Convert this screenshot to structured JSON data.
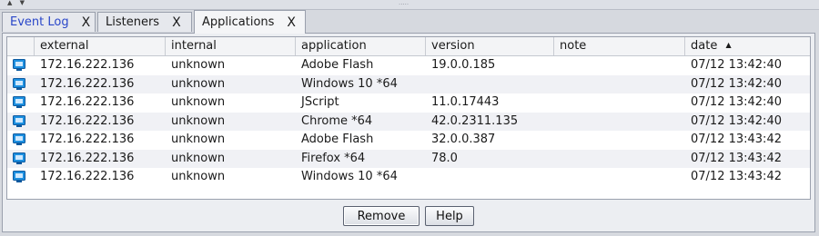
{
  "topbar": {
    "arrows": "▲ ▼",
    "grip": "·····"
  },
  "tabs": [
    {
      "label": "Event Log",
      "close": "X"
    },
    {
      "label": "Listeners",
      "close": "X"
    },
    {
      "label": "Applications",
      "close": "X"
    }
  ],
  "table": {
    "columns": [
      "",
      "external",
      "internal",
      "application",
      "version",
      "note",
      "date"
    ],
    "sort": {
      "column": "date",
      "indicator": "▲"
    },
    "rows": [
      {
        "icon": "monitor-icon",
        "external": "172.16.222.136",
        "internal": "unknown",
        "application": "Adobe Flash",
        "version": "19.0.0.185",
        "note": "",
        "date": "07/12 13:42:40"
      },
      {
        "icon": "monitor-icon",
        "external": "172.16.222.136",
        "internal": "unknown",
        "application": "Windows 10 *64",
        "version": "",
        "note": "",
        "date": "07/12 13:42:40"
      },
      {
        "icon": "monitor-icon",
        "external": "172.16.222.136",
        "internal": "unknown",
        "application": "JScript",
        "version": "11.0.17443",
        "note": "",
        "date": "07/12 13:42:40"
      },
      {
        "icon": "monitor-icon",
        "external": "172.16.222.136",
        "internal": "unknown",
        "application": "Chrome *64",
        "version": "42.0.2311.135",
        "note": "",
        "date": "07/12 13:42:40"
      },
      {
        "icon": "monitor-icon",
        "external": "172.16.222.136",
        "internal": "unknown",
        "application": "Adobe Flash",
        "version": "32.0.0.387",
        "note": "",
        "date": "07/12 13:43:42"
      },
      {
        "icon": "monitor-icon",
        "external": "172.16.222.136",
        "internal": "unknown",
        "application": "Firefox *64",
        "version": "78.0",
        "note": "",
        "date": "07/12 13:43:42"
      },
      {
        "icon": "monitor-icon",
        "external": "172.16.222.136",
        "internal": "unknown",
        "application": "Windows 10 *64",
        "version": "",
        "note": "",
        "date": "07/12 13:43:42"
      }
    ]
  },
  "buttons": {
    "remove": "Remove",
    "help": "Help"
  },
  "colors": {
    "icon_blue": "#1e90e0",
    "tab_link": "#2a47c9"
  }
}
